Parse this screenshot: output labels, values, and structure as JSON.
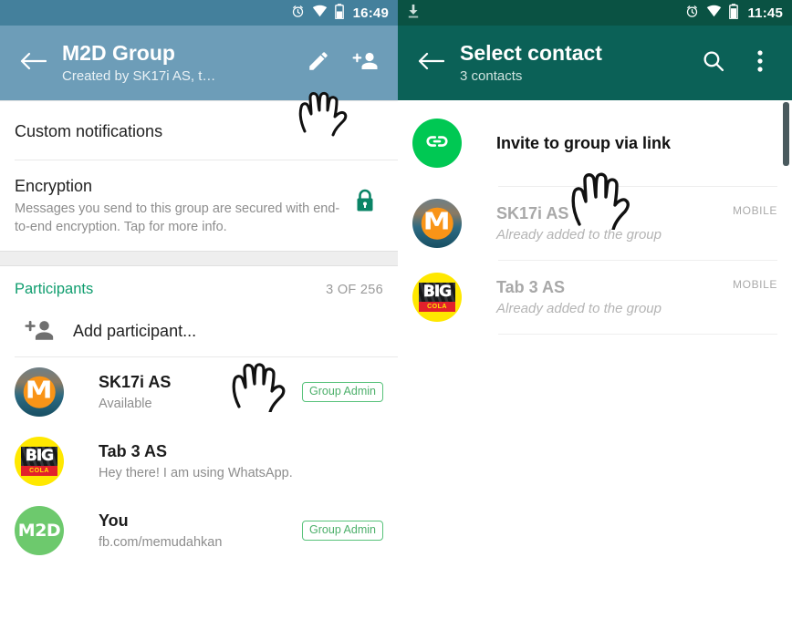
{
  "left_phone": {
    "statusbar": {
      "time": "16:49",
      "icons": [
        "alarm-icon",
        "wifi-icon",
        "battery-icon"
      ]
    },
    "appbar": {
      "back": "back-arrow-icon",
      "title": "M2D Group",
      "subtitle": "Created by SK17i AS, t…",
      "actions": [
        "edit-pencil-icon",
        "add-person-icon"
      ]
    },
    "custom_notifications": {
      "label": "Custom notifications"
    },
    "encryption": {
      "title": "Encryption",
      "description": "Messages you send to this group are secured with end-to-end encryption. Tap for more info.",
      "icon": "lock-icon"
    },
    "participants": {
      "section_title": "Participants",
      "count_label": "3 OF 256",
      "add_label": "Add participant...",
      "add_icon": "add-person-icon",
      "items": [
        {
          "name": "SK17i AS",
          "status": "Available",
          "badge": "Group Admin",
          "avatar": "marshmallow"
        },
        {
          "name": "Tab 3 AS",
          "status": "Hey there! I am using WhatsApp.",
          "badge": "",
          "avatar": "cola"
        },
        {
          "name": "You",
          "status": "fb.com/memudahkan",
          "badge": "Group Admin",
          "avatar": "m2d"
        }
      ]
    }
  },
  "right_phone": {
    "statusbar": {
      "time": "11:45",
      "icons": [
        "download-icon",
        "alarm-icon",
        "wifi-icon",
        "battery-icon"
      ]
    },
    "appbar": {
      "back": "back-arrow-icon",
      "title": "Select contact",
      "subtitle": "3 contacts",
      "actions": [
        "search-icon",
        "overflow-menu-icon"
      ]
    },
    "rows": [
      {
        "name": "Invite to group via link",
        "sub": "",
        "meta": "",
        "avatar": "link",
        "dim": false
      },
      {
        "name": "SK17i AS",
        "sub": "Already added to the group",
        "meta": "MOBILE",
        "avatar": "marshmallow",
        "dim": true
      },
      {
        "name": "Tab 3 AS",
        "sub": "Already added to the group",
        "meta": "MOBILE",
        "avatar": "cola",
        "dim": true
      }
    ]
  },
  "colors": {
    "left_statusbar": "#44809c",
    "left_appbar": "#6d9db8",
    "right_statusbar": "#0a5243",
    "right_appbar": "#0b6157",
    "accent_green": "#0f9d6e",
    "badge_green": "#4caf6a",
    "link_green": "#00c853"
  },
  "cursors": [
    {
      "name": "hand-cursor-edit-icons"
    },
    {
      "name": "hand-cursor-add-participant"
    },
    {
      "name": "hand-cursor-invite-link"
    }
  ]
}
